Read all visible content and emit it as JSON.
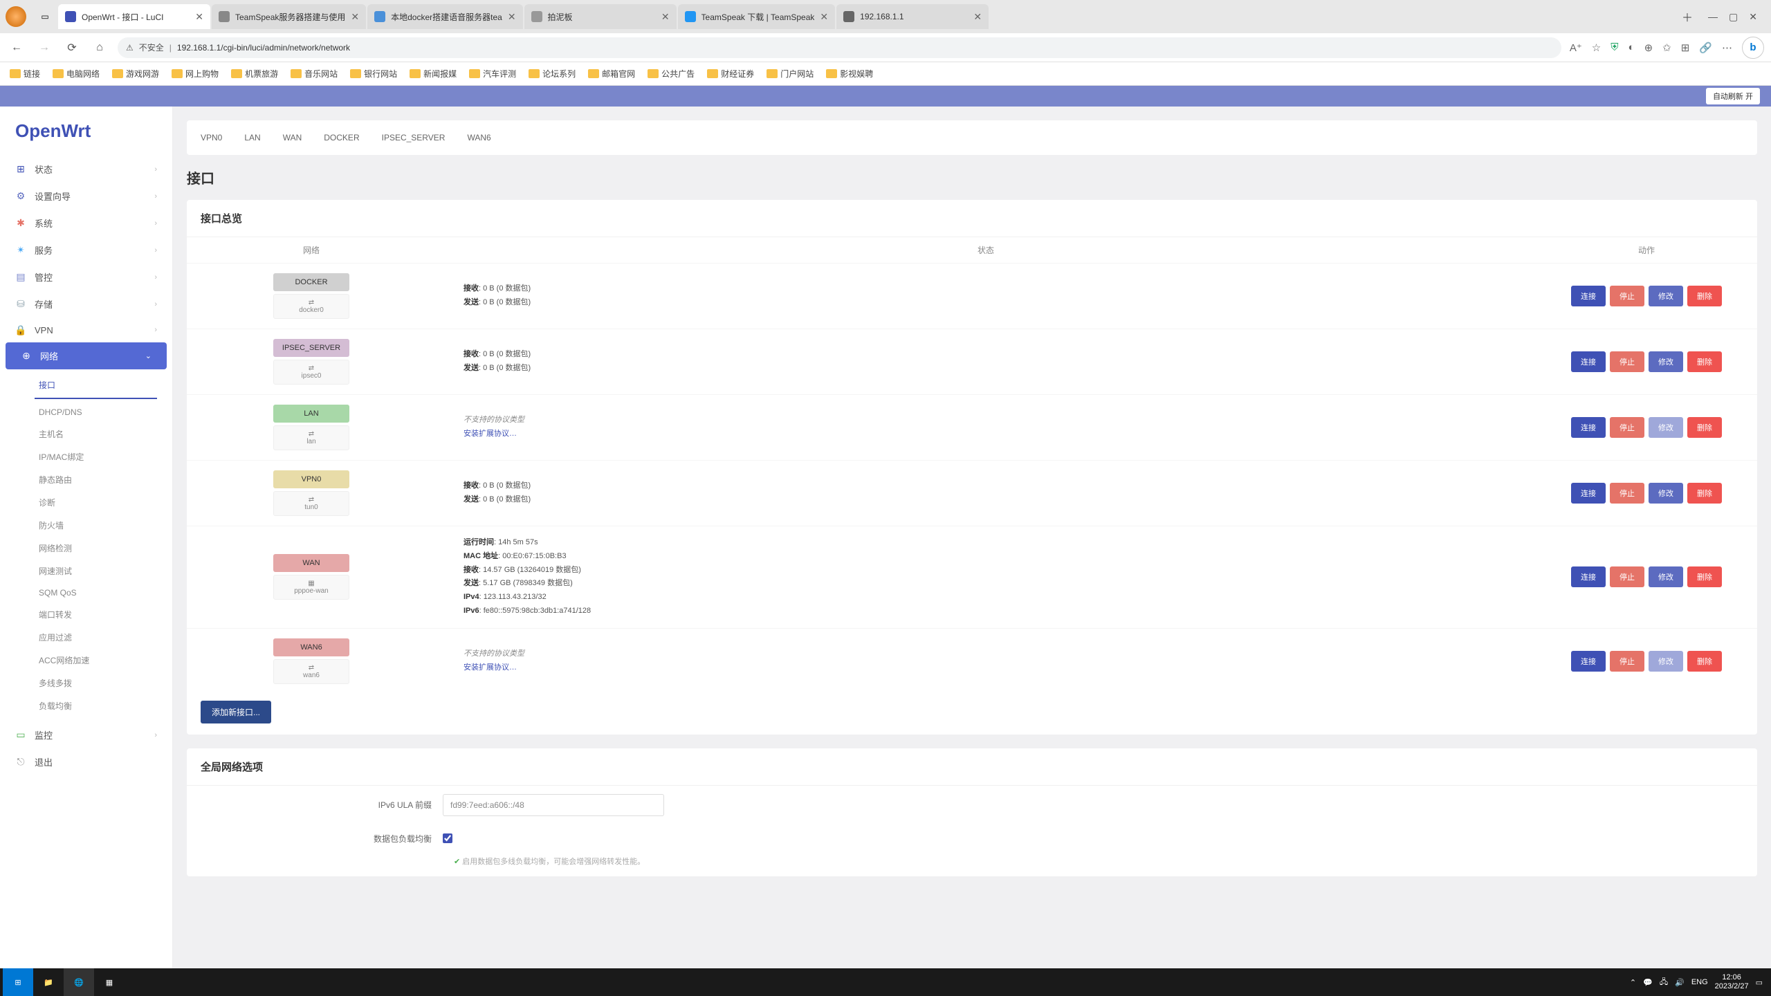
{
  "browser": {
    "tabs": [
      {
        "title": "OpenWrt - 接口 - LuCI",
        "active": true,
        "favColor": "#3f51b5"
      },
      {
        "title": "TeamSpeak服务器搭建与使用",
        "favColor": "#888"
      },
      {
        "title": "本地docker搭建语音服务器tea",
        "favColor": "#4a90d9"
      },
      {
        "title": "拍泥板",
        "favColor": "#999"
      },
      {
        "title": "TeamSpeak 下载 | TeamSpeak",
        "favColor": "#2196f3"
      },
      {
        "title": "192.168.1.1",
        "favColor": "#666"
      }
    ],
    "url_warn": "不安全",
    "url": "192.168.1.1/cgi-bin/luci/admin/network/network",
    "bookmarks": [
      "链接",
      "电脑网络",
      "游戏网游",
      "网上购物",
      "机票旅游",
      "音乐网站",
      "银行网站",
      "新闻报媒",
      "汽车评测",
      "论坛系列",
      "邮箱官网",
      "公共广告",
      "财经证券",
      "门户网站",
      "影视娱聘"
    ]
  },
  "top_button": "自动刷新 开",
  "brand": "OpenWrt",
  "sidebar": {
    "items": [
      {
        "icon": "⊞",
        "label": "状态",
        "color": "#3f51b5"
      },
      {
        "icon": "⚙",
        "label": "设置向导",
        "color": "#5c6bc0"
      },
      {
        "icon": "✱",
        "label": "系统",
        "color": "#e57368"
      },
      {
        "icon": "✴",
        "label": "服务",
        "color": "#42a5f5"
      },
      {
        "icon": "▤",
        "label": "管控",
        "color": "#7986cb"
      },
      {
        "icon": "⛁",
        "label": "存储",
        "color": "#90a4ae"
      },
      {
        "icon": "🔒",
        "label": "VPN",
        "color": "#78909c"
      }
    ],
    "active": {
      "icon": "⊕",
      "label": "网络"
    },
    "subs": [
      "接口",
      "DHCP/DNS",
      "主机名",
      "IP/MAC绑定",
      "静态路由",
      "诊断",
      "防火墙",
      "网络检测",
      "网速测试",
      "SQM QoS",
      "端口转发",
      "应用过滤",
      "ACC网络加速",
      "多线多拨",
      "负载均衡"
    ],
    "tail": [
      {
        "icon": "▭",
        "label": "监控",
        "color": "#4caf50"
      },
      {
        "icon": "⎋",
        "label": "退出",
        "color": "#999"
      }
    ]
  },
  "tabs": [
    "VPN0",
    "LAN",
    "WAN",
    "DOCKER",
    "IPSEC_SERVER",
    "WAN6"
  ],
  "page_title": "接口",
  "overview_title": "接口总览",
  "columns": {
    "net": "网络",
    "stat": "状态",
    "act": "动作"
  },
  "actions": {
    "connect": "连接",
    "stop": "停止",
    "edit": "修改",
    "del": "删除"
  },
  "add_btn": "添加新接口...",
  "interfaces": [
    {
      "name": "DOCKER",
      "dev": "docker0",
      "badge": "#d0d0d0",
      "icon": "⇄",
      "status": [
        {
          "k": "接收",
          "v": "0 B (0 数据包)"
        },
        {
          "k": "发送",
          "v": "0 B (0 数据包)"
        }
      ]
    },
    {
      "name": "IPSEC_SERVER",
      "dev": "ipsec0",
      "badge": "#d4bdd4",
      "icon": "⇄",
      "status": [
        {
          "k": "接收",
          "v": "0 B (0 数据包)"
        },
        {
          "k": "发送",
          "v": "0 B (0 数据包)"
        }
      ]
    },
    {
      "name": "LAN",
      "dev": "lan",
      "badge": "#a8d8a8",
      "icon": "⇄",
      "unsupported": true,
      "light_edit": true
    },
    {
      "name": "VPN0",
      "dev": "tun0",
      "badge": "#e8dca8",
      "icon": "⇄",
      "status": [
        {
          "k": "接收",
          "v": "0 B (0 数据包)"
        },
        {
          "k": "发送",
          "v": "0 B (0 数据包)"
        }
      ]
    },
    {
      "name": "WAN",
      "dev": "pppoe-wan",
      "badge": "#e5a8a8",
      "icon": "▦",
      "status": [
        {
          "k": "运行时间",
          "v": "14h 5m 57s"
        },
        {
          "k": "MAC 地址",
          "v": "00:E0:67:15:0B:B3"
        },
        {
          "k": "接收",
          "v": "14.57 GB (13264019 数据包)"
        },
        {
          "k": "发送",
          "v": "5.17 GB (7898349 数据包)"
        },
        {
          "k": "IPv4",
          "v": "123.113.43.213/32"
        },
        {
          "k": "IPv6",
          "v": "fe80::5975:98cb:3db1:a741/128"
        }
      ]
    },
    {
      "name": "WAN6",
      "dev": "wan6",
      "badge": "#e5a8a8",
      "icon": "⇄",
      "unsupported": true,
      "light_edit": true
    }
  ],
  "unsupported_text": "不支持的协议类型",
  "install_link": "安装扩展协议…",
  "global_title": "全局网络选项",
  "ula_label": "IPv6 ULA 前缀",
  "ula_value": "fd99:7eed:a606::/48",
  "balance_label": "数据包负载均衡",
  "balance_help": "启用数据包多线负载均衡，可能会增强网络转发性能。",
  "taskbar": {
    "lang": "ENG",
    "time": "12:06",
    "date": "2023/2/27"
  }
}
